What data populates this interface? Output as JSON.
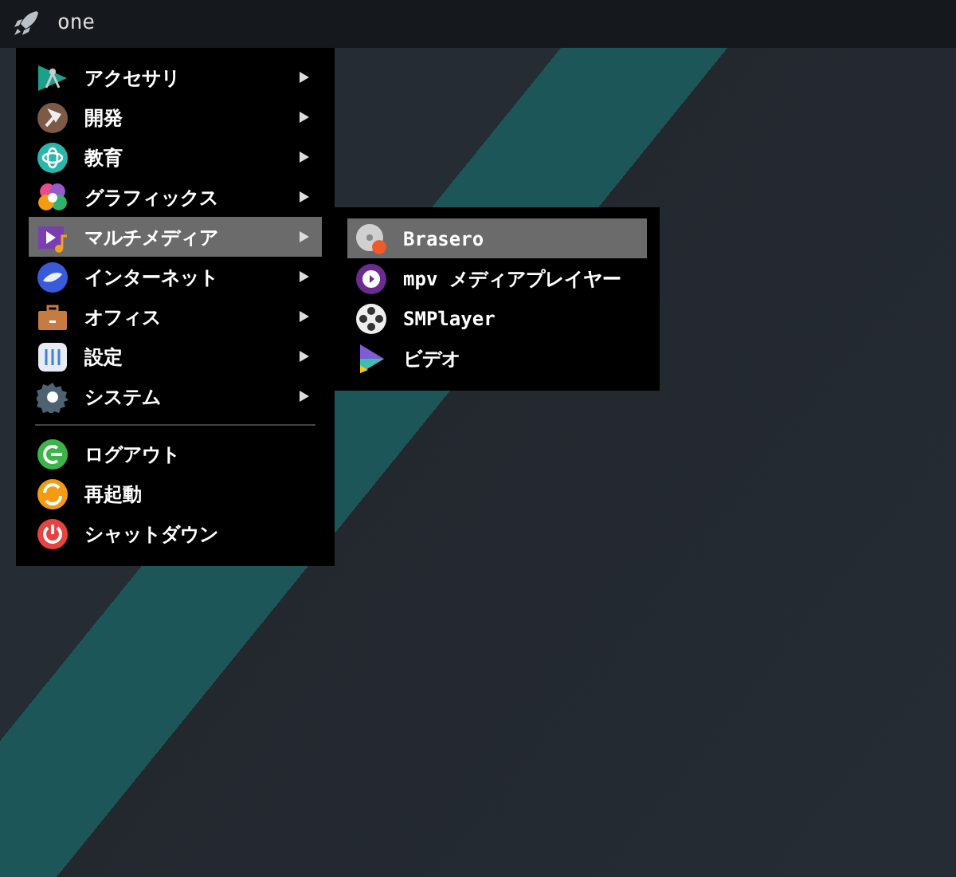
{
  "panel": {
    "title": "one"
  },
  "menu": {
    "sections": [
      {
        "items": [
          {
            "label": "アクセサリ",
            "has_submenu": true,
            "selected": false
          },
          {
            "label": "開発",
            "has_submenu": true,
            "selected": false
          },
          {
            "label": "教育",
            "has_submenu": true,
            "selected": false
          },
          {
            "label": "グラフィックス",
            "has_submenu": true,
            "selected": false
          },
          {
            "label": "マルチメディア",
            "has_submenu": true,
            "selected": true
          },
          {
            "label": "インターネット",
            "has_submenu": true,
            "selected": false
          },
          {
            "label": "オフィス",
            "has_submenu": true,
            "selected": false
          },
          {
            "label": "設定",
            "has_submenu": true,
            "selected": false
          },
          {
            "label": "システム",
            "has_submenu": true,
            "selected": false
          }
        ]
      },
      {
        "items": [
          {
            "label": "ログアウト",
            "has_submenu": false,
            "selected": false
          },
          {
            "label": "再起動",
            "has_submenu": false,
            "selected": false
          },
          {
            "label": "シャットダウン",
            "has_submenu": false,
            "selected": false
          }
        ]
      }
    ]
  },
  "submenu": {
    "items": [
      {
        "label": "Brasero",
        "selected": true
      },
      {
        "label": "mpv メディアプレイヤー",
        "selected": false
      },
      {
        "label": "SMPlayer",
        "selected": false
      },
      {
        "label": "ビデオ",
        "selected": false
      }
    ]
  }
}
